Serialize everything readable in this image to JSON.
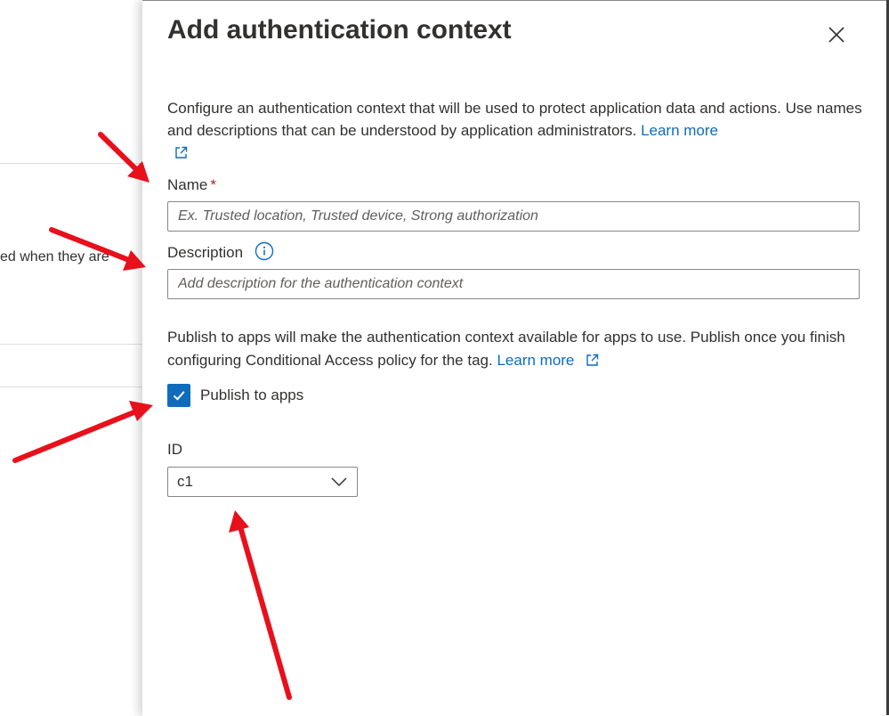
{
  "background": {
    "partial_text": "ed when they are"
  },
  "panel": {
    "title": "Add authentication context",
    "intro_text": "Configure an authentication context that will be used to protect application data and actions. Use names and descriptions that can be understood by application administrators.",
    "intro_link": "Learn more",
    "name_label": "Name",
    "name_required_marker": "*",
    "name_placeholder": "Ex. Trusted location, Trusted device, Strong authorization",
    "description_label": "Description",
    "description_placeholder": "Add description for the authentication context",
    "publish_text": "Publish to apps will make the authentication context available for apps to use. Publish once you finish configuring Conditional Access policy for the tag.",
    "publish_link": "Learn more",
    "publish_checkbox_label": "Publish to apps",
    "publish_checked": true,
    "id_label": "ID",
    "id_value": "c1"
  },
  "icons": {
    "close": "close-icon",
    "external_link": "external-link-icon",
    "info": "info-icon",
    "checkmark": "checkmark-icon",
    "chevron": "chevron-down-icon"
  },
  "colors": {
    "accent": "#0f6cbd",
    "required": "#a4262c",
    "annotation_arrow": "#e8101b"
  }
}
